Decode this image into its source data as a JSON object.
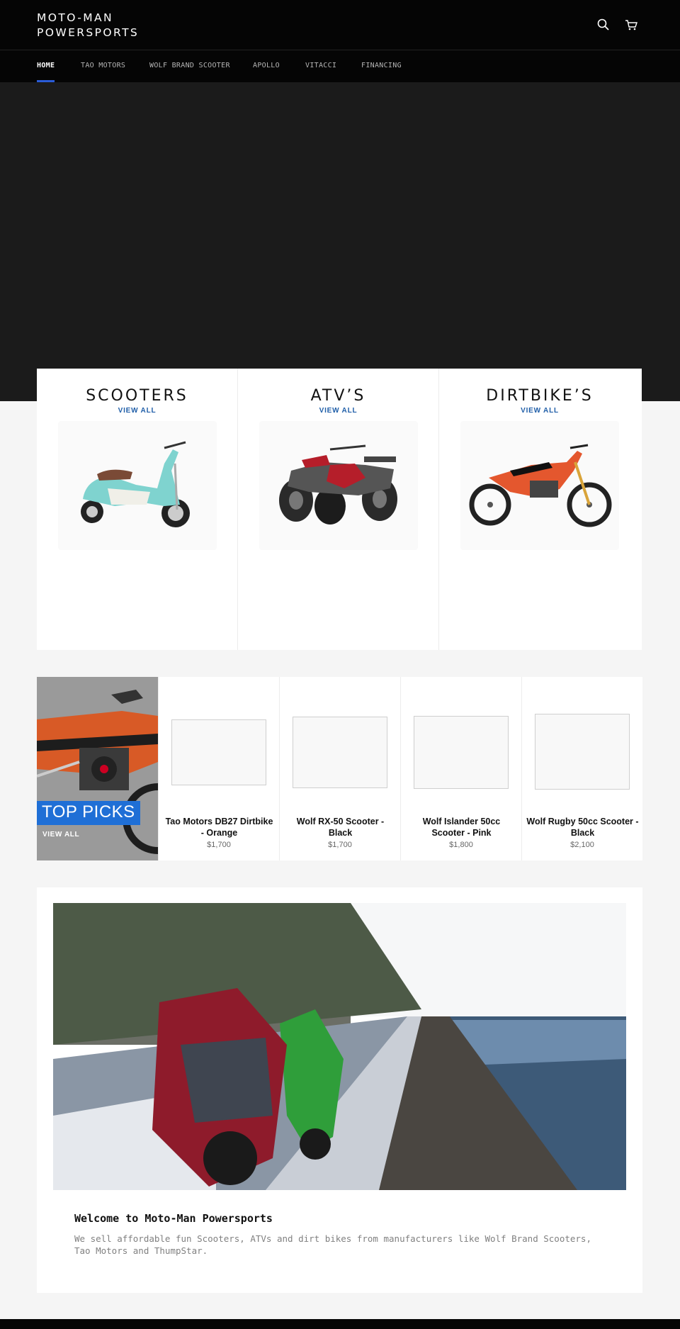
{
  "header": {
    "logo_line1": "MOTO-MAN",
    "logo_line2": "POWERSPORTS",
    "search_icon": "search-icon",
    "cart_icon": "cart-icon"
  },
  "nav": {
    "items": [
      {
        "label": "HOME",
        "active": true
      },
      {
        "label": "TAO MOTORS"
      },
      {
        "label": "WOLF BRAND SCOOTER"
      },
      {
        "label": "APOLLO"
      },
      {
        "label": "VITACCI"
      },
      {
        "label": "FINANCING"
      }
    ],
    "accent_color": "#2a5bd7"
  },
  "collections": [
    {
      "title": "SCOOTERS",
      "link": "VIEW ALL"
    },
    {
      "title": "ATV’S",
      "link": "VIEW ALL"
    },
    {
      "title": "DIRTBIKE’S",
      "link": "VIEW ALL"
    }
  ],
  "top_picks": {
    "title": "TOP PICKS",
    "link": "VIEW ALL",
    "products": [
      {
        "name": "Tao Motors DB27 Dirtbike - Orange",
        "price": "$1,700"
      },
      {
        "name": "Wolf RX-50 Scooter - Black",
        "price": "$1,700"
      },
      {
        "name": "Wolf Islander 50cc Scooter - Pink",
        "price": "$1,800"
      },
      {
        "name": "Wolf Rugby 50cc Scooter - Black",
        "price": "$2,100"
      }
    ]
  },
  "welcome": {
    "title": "Welcome to Moto-Man Powersports",
    "text": "We sell affordable fun Scooters, ATVs and dirt bikes from manufacturers like Wolf Brand Scooters, Tao Motors and ThumpStar."
  },
  "colors": {
    "header_bg": "#050505",
    "hero_bg": "#1b1b1b",
    "link_blue": "#1f5ea8",
    "top_picks_blue": "#1f6fd6"
  }
}
